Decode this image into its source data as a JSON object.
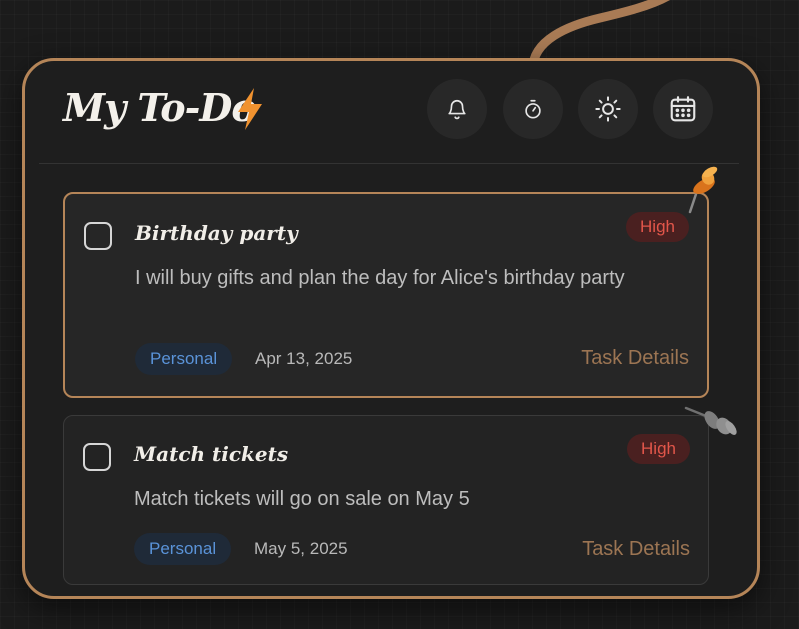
{
  "app": {
    "title": "My To-Do",
    "title_icon": "lightning-bolt-icon",
    "accent_color": "#b58558"
  },
  "toolbar": {
    "buttons": [
      {
        "icon": "bell-icon",
        "action": "notifications"
      },
      {
        "icon": "timer-icon",
        "action": "timer"
      },
      {
        "icon": "sun-icon",
        "action": "theme"
      },
      {
        "icon": "calendar-icon",
        "action": "calendar"
      }
    ]
  },
  "tasks": [
    {
      "title": "Birthday party",
      "priority": "High",
      "description": "I will buy gifts and plan the day for Alice's birthday party",
      "tag": "Personal",
      "date": "Apr 13, 2025",
      "details_label": "Task Details",
      "pinned": true,
      "pin_icon": "pushpin-icon"
    },
    {
      "title": "Match tickets",
      "priority": "High",
      "description": "Match tickets will go on sale on May 5",
      "tag": "Personal",
      "date": "May 5, 2025",
      "details_label": "Task Details",
      "pinned": false,
      "pin_icon": "pushpin-icon"
    }
  ],
  "colors": {
    "priority_high_text": "#e2564a",
    "priority_high_bg": "#4a2020",
    "tag_text": "#5a93d8",
    "tag_bg": "#1f2a38",
    "details_text": "#9c7553"
  }
}
